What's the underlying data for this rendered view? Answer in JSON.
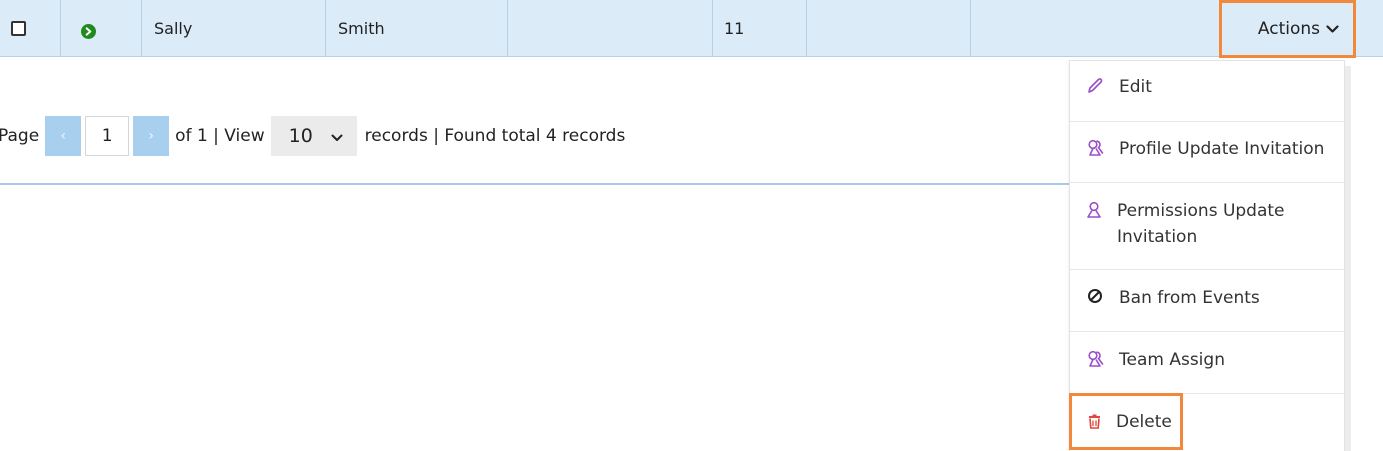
{
  "row": {
    "first_name": "Sally",
    "last_name": "Smith",
    "number": "11",
    "status_icon": "play-circle-icon",
    "status_color": "#1f8a1f"
  },
  "actions": {
    "label": "Actions",
    "icon": "chevron-down-icon",
    "highlight_color": "#f2883a"
  },
  "pager": {
    "page_label": "Page",
    "current_page": "1",
    "of_text": "of 1 | View",
    "page_size": "10",
    "records_text": "records | Found total 4 records"
  },
  "menu": {
    "items": [
      {
        "label": "Edit",
        "icon": "pencil-icon"
      },
      {
        "label": "Profile Update Invitation",
        "icon": "users-icon"
      },
      {
        "label": "Permissions Update Invitation",
        "icon": "user-icon"
      },
      {
        "label": "Ban from Events",
        "icon": "ban-icon"
      },
      {
        "label": "Team Assign",
        "icon": "users-icon"
      },
      {
        "label": "Delete",
        "icon": "trash-icon"
      }
    ],
    "icon_color": "#9b4dca",
    "delete_color": "#e0463c"
  }
}
